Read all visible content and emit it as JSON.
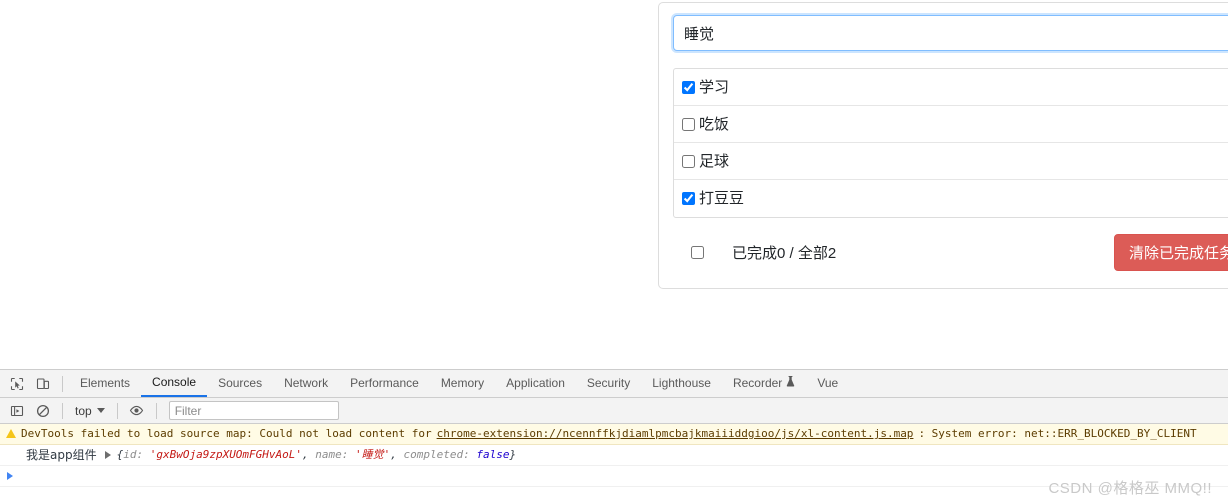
{
  "app": {
    "input": {
      "value": "睡觉",
      "placeholder": ""
    },
    "todos": [
      {
        "label": "学习",
        "checked": true
      },
      {
        "label": "吃饭",
        "checked": false
      },
      {
        "label": "足球",
        "checked": false
      },
      {
        "label": "打豆豆",
        "checked": true
      }
    ],
    "footer": {
      "select_all_checked": false,
      "count_text": "已完成0 / 全部2",
      "clear_button_label": "清除已完成任务",
      "clear_button_color": "#dc5c57"
    }
  },
  "devtools": {
    "toolbar_icons": [
      {
        "name": "inspect-element-icon"
      },
      {
        "name": "device-toolbar-icon"
      }
    ],
    "tabs": [
      {
        "label": "Elements",
        "active": false
      },
      {
        "label": "Console",
        "active": true
      },
      {
        "label": "Sources",
        "active": false
      },
      {
        "label": "Network",
        "active": false
      },
      {
        "label": "Performance",
        "active": false
      },
      {
        "label": "Memory",
        "active": false
      },
      {
        "label": "Application",
        "active": false
      },
      {
        "label": "Security",
        "active": false
      },
      {
        "label": "Lighthouse",
        "active": false
      },
      {
        "label": "Recorder",
        "active": false,
        "badge": "flask-icon"
      },
      {
        "label": "Vue",
        "active": false
      }
    ],
    "active_tab_color": "#1a73e8",
    "filterbar": {
      "context_label": "top",
      "filter_placeholder": "Filter"
    },
    "console": {
      "warning": {
        "text_before": "DevTools failed to load source map: Could not load content for ",
        "link": "chrome-extension://ncennffkjdiamlpmcbajkmaiiiddgioo/js/xl-content.js.map",
        "text_after": ": System error: net::ERR_BLOCKED_BY_CLIENT",
        "background": "#fffbe5"
      },
      "log": {
        "message": "我是app组件",
        "object": {
          "open_brace": "{",
          "key_id": "id: ",
          "val_id": "'gxBwOja9zpXUOmFGHvAoL'",
          "comma1": ", ",
          "key_name": "name: ",
          "val_name": "'睡觉'",
          "comma2": ", ",
          "key_completed": "completed: ",
          "val_completed": "false",
          "close_brace": "}"
        }
      }
    }
  },
  "watermark": {
    "text": "CSDN @格格巫 MMQ!!"
  }
}
